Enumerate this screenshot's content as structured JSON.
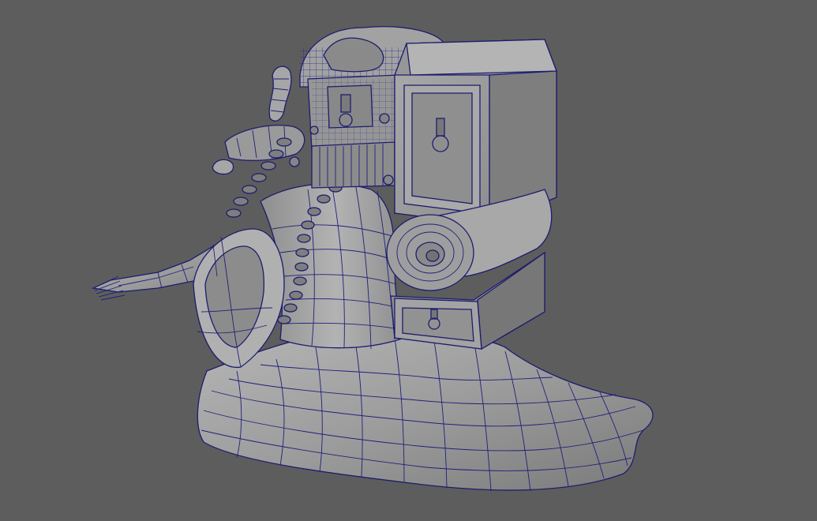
{
  "viewport": {
    "background": "#5d5d5d",
    "shading": "wireframe-on-shaded",
    "wire_color": "#20207a",
    "surface_color": "#9a9a9a"
  },
  "model": {
    "parts": [
      "snail-foot-body-mesh",
      "shell-neck-mesh",
      "fork-horn-mesh",
      "treasure-chest-mesh",
      "cabinet-box-mesh",
      "drawer-mesh",
      "scroll-roll-mesh",
      "chain-mesh",
      "eye-stalk-mesh",
      "antenna-mesh"
    ]
  }
}
